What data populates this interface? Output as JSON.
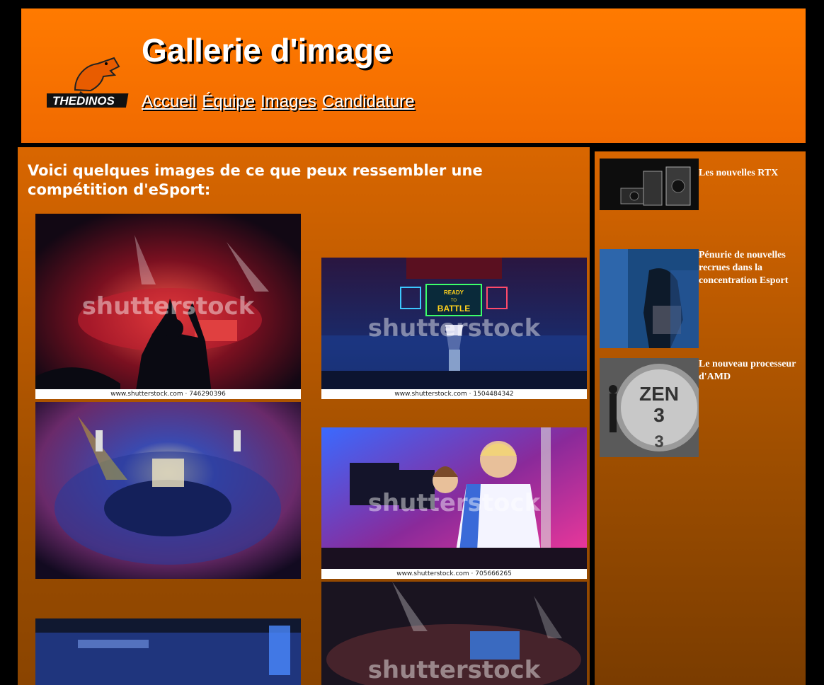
{
  "header": {
    "title": "Gallerie d'image",
    "logo_text": "THEDINOS",
    "nav": [
      "Accueil",
      "Équipe",
      "Images",
      "Candidature"
    ]
  },
  "main": {
    "heading": "Voici quelques images de ce que peux ressembler une compétition d'eSport:",
    "watermark": "shutterstock",
    "captions": {
      "img1": "www.shutterstock.com · 746290396",
      "img2": "www.shutterstock.com · 1504484342",
      "img4": "www.shutterstock.com · 705666265"
    },
    "neon_sign": [
      "READY",
      "TO",
      "BATTLE"
    ]
  },
  "sidebar": {
    "items": [
      {
        "title": "Les nouvelles RTX"
      },
      {
        "title": "Pénurie de nouvelles recrues dans la concentration Esport"
      },
      {
        "title": "Le nouveau processeur d'AMD",
        "image_text": "ZEN 3"
      }
    ]
  },
  "colors": {
    "header_orange": "#ff7a00",
    "panel_orange": "#d96600",
    "panel_brown": "#8a4400"
  }
}
